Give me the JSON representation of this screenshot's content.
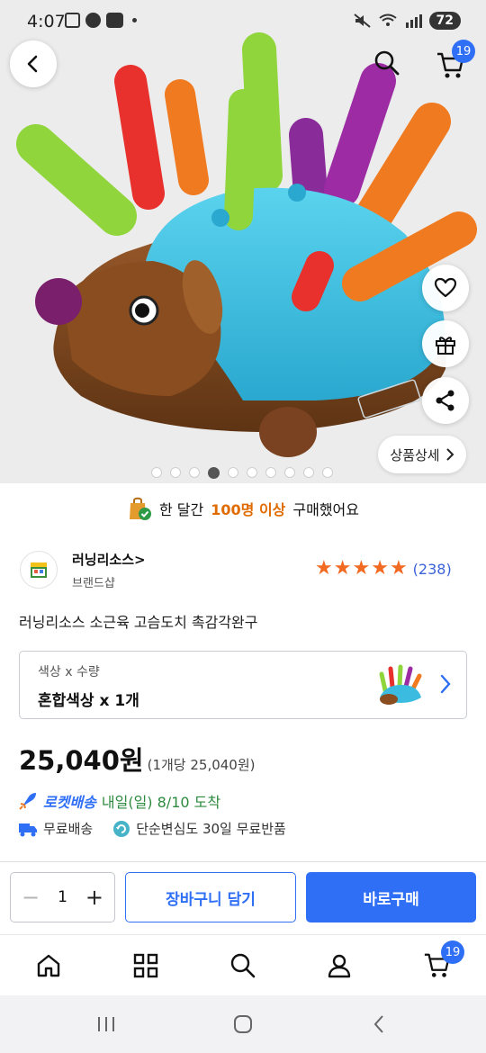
{
  "status_bar": {
    "time": "4:07",
    "battery": "72"
  },
  "hero": {
    "image_alt": "hedgehog-fine-motor-toy",
    "cart_count": "19",
    "detail_button": "상품상세",
    "page_dots": 10,
    "active_dot": 3
  },
  "purchase_banner": {
    "prefix": "한 달간",
    "highlight": "100명 이상",
    "suffix": "구매했어요"
  },
  "seller": {
    "name": "러닝리소스",
    "subtitle": "브랜드샵",
    "rating": 5,
    "review_count": "(238)"
  },
  "product": {
    "title": "러닝리소스 소근육 고슴도치 촉감각완구"
  },
  "option": {
    "label": "색상 x 수량",
    "value": "혼합색상 x 1개"
  },
  "price": {
    "amount": "25,040원",
    "unit_price": "(1개당 25,040원)"
  },
  "delivery": {
    "rocket_label": "로켓배송",
    "arrival": "내일(일) 8/10 도착",
    "free_shipping": "무료배송",
    "free_return": "단순변심도 30일 무료반품"
  },
  "actions": {
    "quantity": "1",
    "add_to_cart": "장바구니 담기",
    "buy_now": "바로구매"
  },
  "bottom_nav": {
    "cart_count": "19",
    "items": [
      "home-icon",
      "category-icon",
      "search-icon",
      "user-icon",
      "cart-icon"
    ]
  },
  "colors": {
    "accent": "#2f6ff6",
    "rating": "#f26a21",
    "highlight": "#e06b00",
    "rocket_date": "#2d8a3e"
  }
}
